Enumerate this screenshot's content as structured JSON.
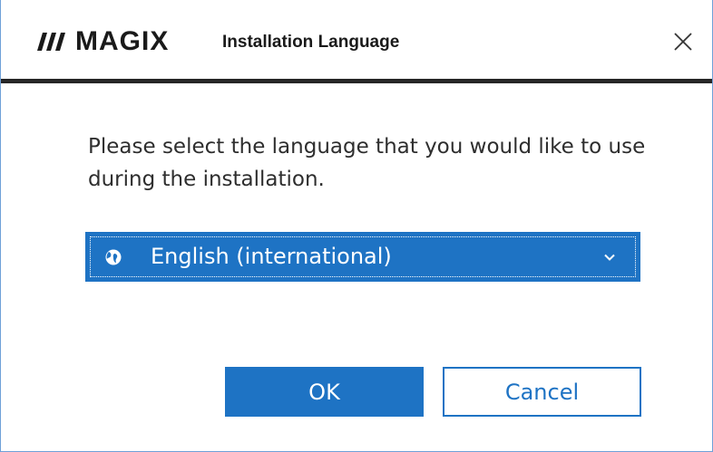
{
  "window": {
    "brand_name": "MAGIX",
    "title": "Installation Language",
    "close_icon": "close-icon"
  },
  "main": {
    "prompt": "Please select the language that you would like to use during the installation.",
    "language_select": {
      "selected": "English (international)",
      "icon": "globe-icon"
    }
  },
  "buttons": {
    "ok_label": "OK",
    "cancel_label": "Cancel"
  },
  "colors": {
    "accent": "#1e73c4",
    "title_rule": "#262626",
    "text": "#2e2e2e"
  }
}
